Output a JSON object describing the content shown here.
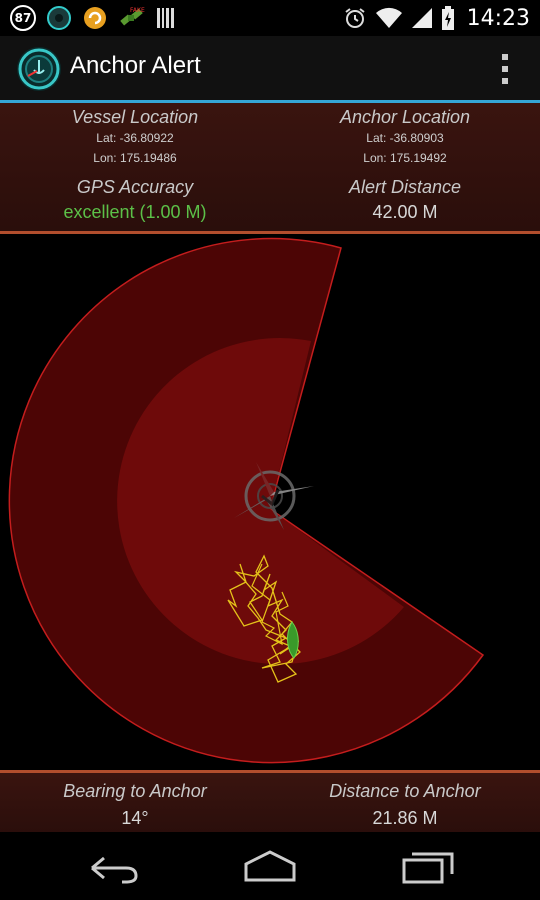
{
  "statusbar": {
    "badge_count": "87",
    "time": "14:23"
  },
  "app": {
    "title": "Anchor Alert"
  },
  "vessel": {
    "heading": "Vessel Location",
    "lat": "Lat: -36.80922",
    "lon": "Lon: 175.19486"
  },
  "anchor": {
    "heading": "Anchor Location",
    "lat": "Lat: -36.80903",
    "lon": "Lon: 175.19492"
  },
  "gps": {
    "heading": "GPS Accuracy",
    "value": "excellent (1.00 M)"
  },
  "alert": {
    "heading": "Alert Distance",
    "value": "42.00 M"
  },
  "bearing": {
    "heading": "Bearing to Anchor",
    "value": "14°"
  },
  "distance": {
    "heading": "Distance to Anchor",
    "value": "21.86 M"
  },
  "colors": {
    "accent_line": "#35a6d6",
    "panel_border": "#b24e2d",
    "gps_good": "#5cc048",
    "alarm_zone": "#7a0a0a",
    "track": "#e5c21a",
    "vessel": "#3a9a2a"
  },
  "icons": [
    "badge-87-icon",
    "compass-app-icon",
    "sync-icon",
    "satellite-icon",
    "barcode-icon",
    "alarm-clock-icon",
    "wifi-icon",
    "signal-icon",
    "battery-charging-icon",
    "overflow-menu-icon",
    "back-icon",
    "home-icon",
    "recents-icon"
  ]
}
